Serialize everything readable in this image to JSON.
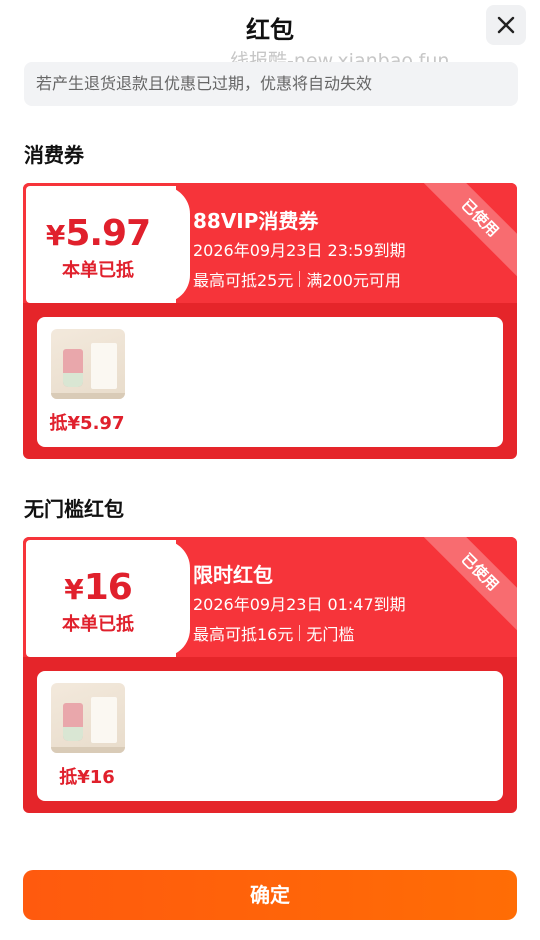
{
  "header": {
    "title": "红包",
    "watermark": "线报酷-new.xianbao.fun"
  },
  "notice": "若产生退货退款且优惠已过期，优惠将自动失效",
  "sections": [
    {
      "title": "消费券",
      "coupon": {
        "currency": "¥",
        "amount": "5.97",
        "amount_label": "本单已抵",
        "name": "88VIP消费券",
        "expiry": "2026年09月23日 23:59到期",
        "rule_max": "最高可抵25元",
        "rule_threshold": "满200元可用",
        "status": "已使用",
        "item_deduct": "抵¥5.97"
      }
    },
    {
      "title": "无门槛红包",
      "coupon": {
        "currency": "¥",
        "amount": "16",
        "amount_label": "本单已抵",
        "name": "限时红包",
        "expiry": "2026年09月23日 01:47到期",
        "rule_max": "最高可抵16元",
        "rule_threshold": "无门槛",
        "status": "已使用",
        "item_deduct": "抵¥16"
      }
    }
  ],
  "confirm_label": "确定",
  "colors": {
    "coupon_red": "#f6343a",
    "coupon_border": "#e5252a",
    "amount_red": "#e0202c",
    "button_orange": "#ff5a0e"
  }
}
